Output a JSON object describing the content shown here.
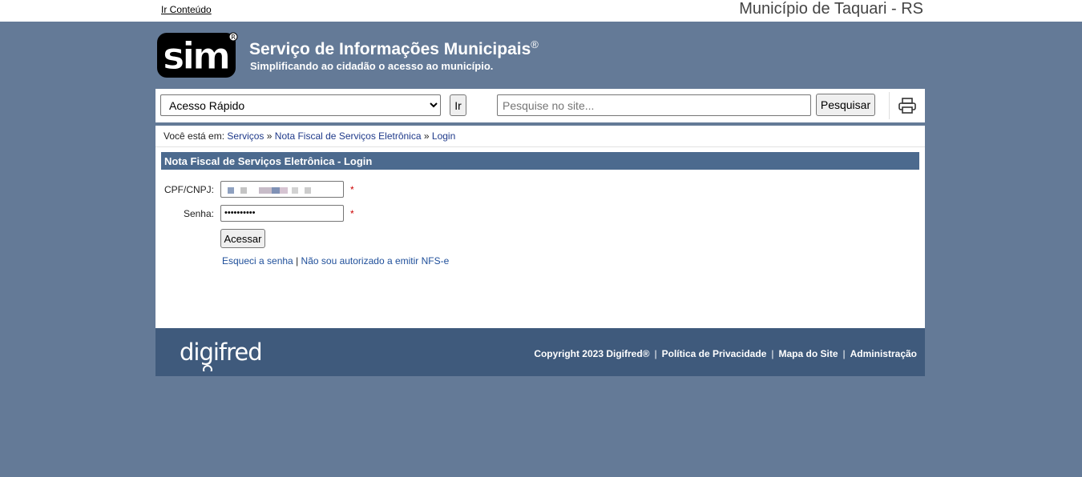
{
  "topbar": {
    "skip_link": "Ir Conteúdo",
    "municipality": "Município de Taquari - RS"
  },
  "brand": {
    "logo_text": "sim",
    "title": "Serviço de Informações Municipais",
    "title_mark": "®",
    "subtitle": "Simplificando ao cidadão o acesso ao município."
  },
  "toolbar": {
    "quick_access_selected": "Acesso Rápido",
    "go_label": "Ir",
    "search_placeholder": "Pesquise no site...",
    "search_label": "Pesquisar",
    "print_icon": "printer-icon"
  },
  "breadcrumb": {
    "prefix": "Você está em:",
    "items": [
      "Serviços",
      "Nota Fiscal de Serviços Eletrônica",
      "Login"
    ],
    "separator": "»"
  },
  "form": {
    "header": "Nota Fiscal de Serviços Eletrônica - Login",
    "cpf_label": "CPF/CNPJ:",
    "password_label": "Senha:",
    "password_value": "••••••••••",
    "required_mark": "*",
    "submit_label": "Acessar",
    "forgot_link": "Esqueci a senha",
    "link_separator": "|",
    "not_authorized_link": "Não sou autorizado a emitir NFS-e"
  },
  "footer": {
    "logo_text": "digifred",
    "copyright": "Copyright 2023 Digifred®",
    "privacy": "Política de Privacidade",
    "sitemap": "Mapa do Site",
    "admin": "Administração",
    "separator": "|"
  },
  "colors": {
    "background": "#647a97",
    "header_bar": "#4c6a8e",
    "footer": "#3f5a7c",
    "link": "#1f3a8a"
  }
}
